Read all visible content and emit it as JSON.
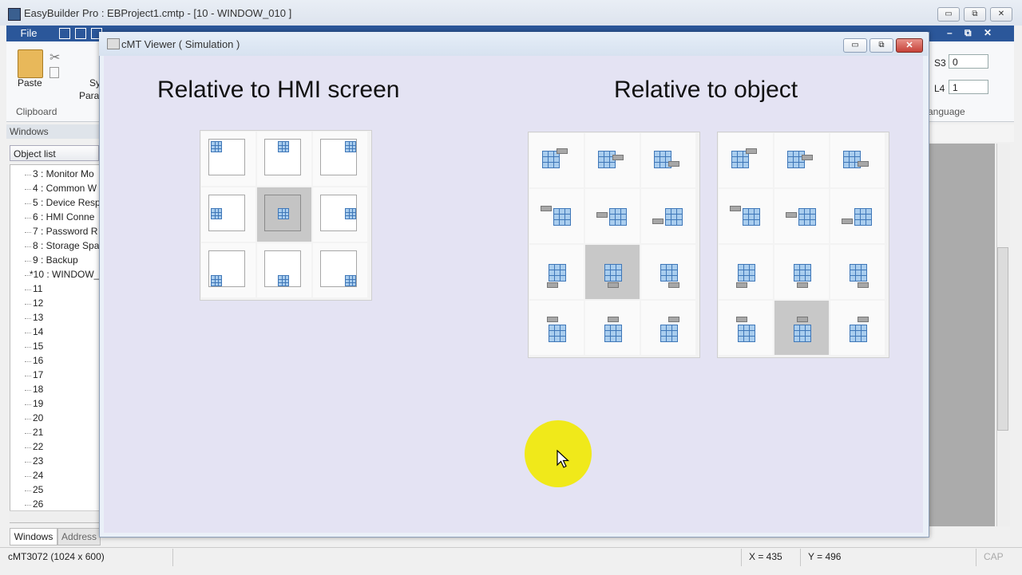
{
  "app": {
    "title": "EasyBuilder Pro : EBProject1.cmtp - [10 - WINDOW_010 ]",
    "file_tab": "File",
    "window_controls": {
      "minimize": "▭",
      "restore": "⧉",
      "close": "✕"
    }
  },
  "ribbon": {
    "paste_label": "Paste",
    "clipboard_label": "Clipboard",
    "sys_label": "Sy",
    "para_label": "Para",
    "s3_label": "S3",
    "s3_value": "0",
    "l4_label": "L4",
    "l4_value": "1",
    "language_label": "anguage",
    "tab_controls": [
      "–",
      "⧉",
      "✕"
    ]
  },
  "left_panel": {
    "header": "Windows",
    "object_list": "Object list",
    "tree_items": [
      "3 : Monitor Mo",
      "4 : Common W",
      "5 : Device Resp",
      "6 : HMI Conne",
      "7 : Password R",
      "8 : Storage Spa",
      "9 : Backup",
      "*10 : WINDOW_",
      "11",
      "12",
      "13",
      "14",
      "15",
      "16",
      "17",
      "18",
      "19",
      "20",
      "21",
      "22",
      "23",
      "24",
      "25",
      "26"
    ],
    "tabs": [
      "Windows",
      "Address"
    ]
  },
  "status_bar": {
    "model": "cMT3072 (1024 x 600)",
    "x": "X = 435",
    "y": "Y = 496",
    "cap": "CAP"
  },
  "viewer": {
    "title": "cMT Viewer ( Simulation )",
    "controls": {
      "minimize": "▭",
      "restore": "⧉",
      "close": "✕"
    },
    "heading_left": "Relative to HMI screen",
    "heading_right": "Relative to object",
    "screen_grid_selected": "middle-center",
    "object_grid_1_selected": "row3-center",
    "object_grid_2_selected": "row4-center"
  },
  "colors": {
    "ribbon_blue": "#2b579a",
    "canvas": "#e4e3f3",
    "highlight": "#f0e90e",
    "object_fill": "#a9cdee",
    "object_stroke": "#3f77b8"
  }
}
